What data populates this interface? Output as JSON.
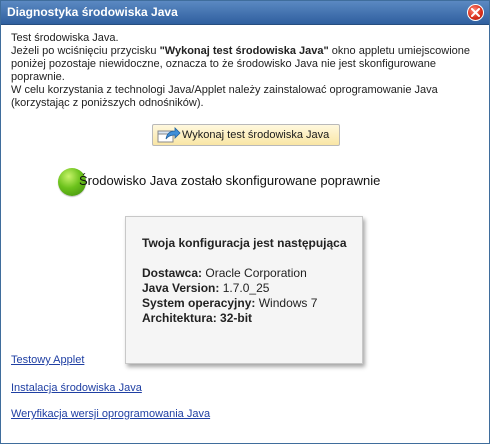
{
  "window": {
    "title": "Diagnostyka środowiska Java"
  },
  "intro": {
    "line1": "Test środowiska Java.",
    "line2_pre": "Jeżeli po wciśnięciu przycisku ",
    "line2_bold": "\"Wykonaj test środowiska Java\"",
    "line2_post": " okno appletu umiejscowione poniżej pozostaje niewidoczne, oznacza to że środowisko Java nie jest skonfigurowane poprawnie.",
    "line3": "W celu korzystania z technologi Java/Applet należy zainstalować oprogramowanie Java (korzystając z poniższych odnośników)."
  },
  "run_button": {
    "label": "Wykonaj test środowiska Java",
    "icon": "applet-arrow-icon"
  },
  "status": {
    "text": "Środowisko Java zostało skonfigurowane poprawnie",
    "color": "#5cb819",
    "state": "ok"
  },
  "config": {
    "title": "Twoja konfiguracja jest następująca",
    "vendor_label": "Dostawca:",
    "vendor_value": " Oracle Corporation",
    "java_version_label": "Java Version:",
    "java_version_value": " 1.7.0_25",
    "os_label": "System operacyjny:",
    "os_value": " Windows 7",
    "arch_label": "Architektura:",
    "arch_value": " 32-bit"
  },
  "links": {
    "test_applet": "Testowy Applet",
    "install_java": "Instalacja środowiska Java",
    "verify_java": "Weryfikacja wersji oprogramowania Java"
  },
  "colors": {
    "titlebar": "#3a6aa8",
    "link": "#1f3fa3",
    "button": "#f9e6a5",
    "close": "#d9301c"
  }
}
